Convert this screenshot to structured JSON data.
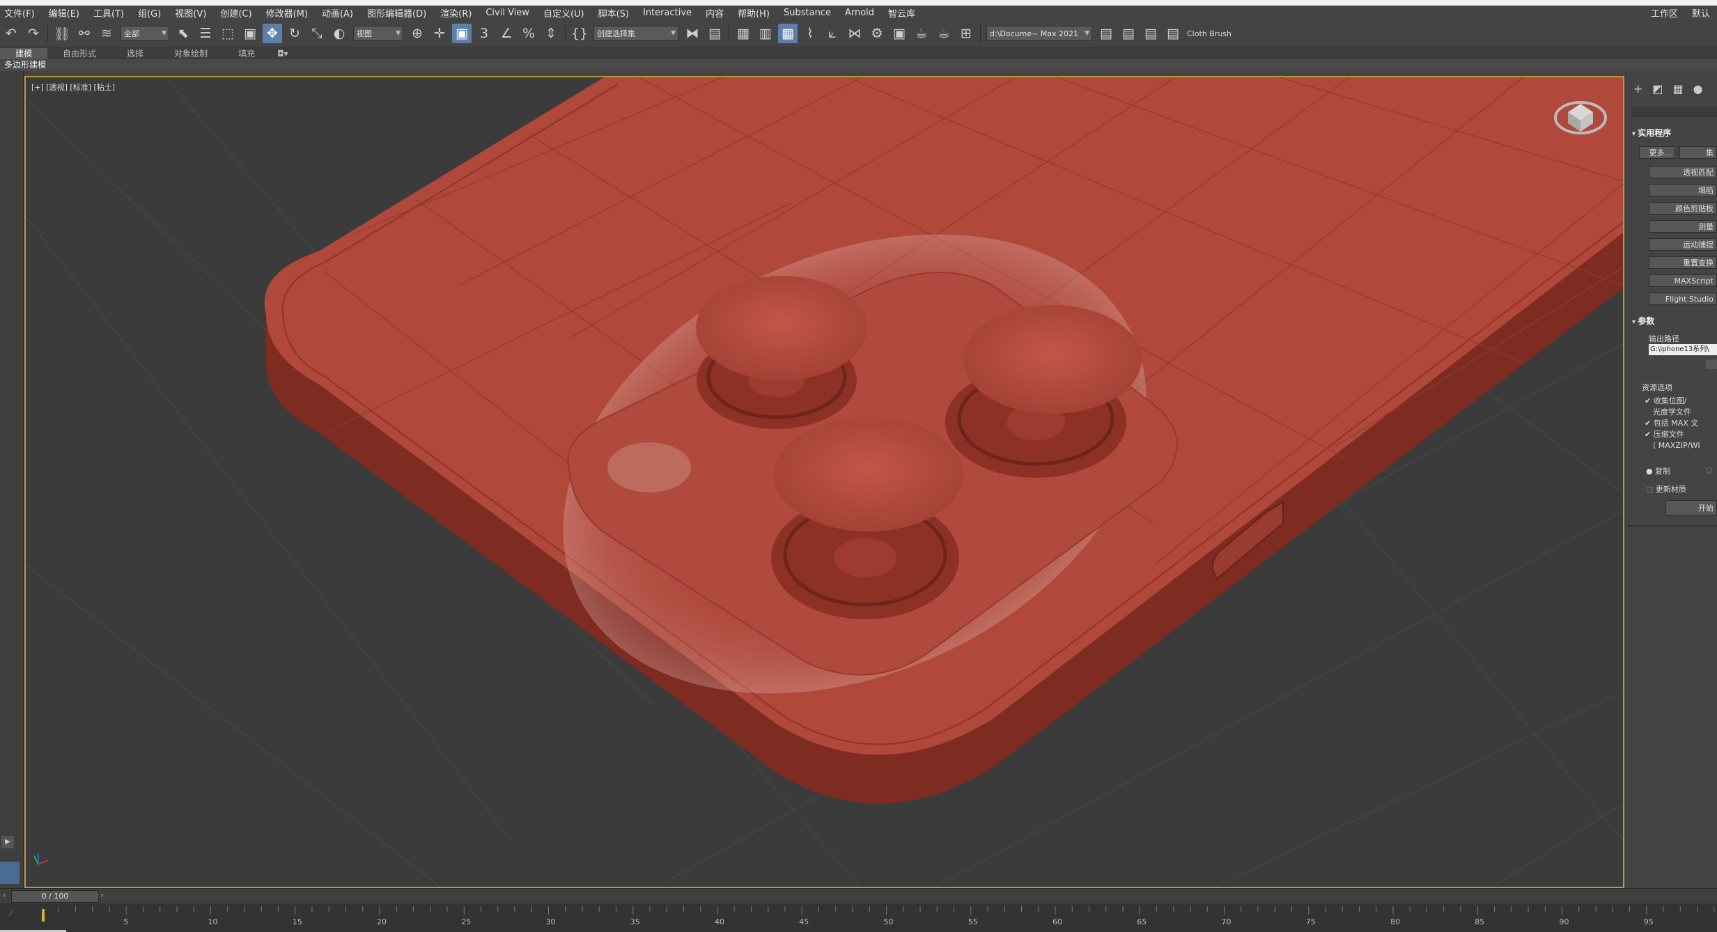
{
  "menu": {
    "items": [
      "文件(F)",
      "编辑(E)",
      "工具(T)",
      "组(G)",
      "视图(V)",
      "创建(C)",
      "修改器(M)",
      "动画(A)",
      "图形编辑器(D)",
      "渲染(R)",
      "Civil View",
      "自定义(U)",
      "脚本(S)",
      "Interactive",
      "内容",
      "帮助(H)",
      "Substance",
      "Arnold",
      "智云库"
    ],
    "right": [
      "工作区",
      "默认"
    ]
  },
  "toolbar": {
    "selection_filter": "全部",
    "coord_system": "视图",
    "named_selection": "创建选择集",
    "project_path": "d:\\Docume~ Max 2021",
    "extra_label": "Cloth Brush"
  },
  "ribbon": {
    "tabs": [
      "建模",
      "自由形式",
      "选择",
      "对象绘制",
      "填充"
    ],
    "active": "建模",
    "sub_label": "多边形建模"
  },
  "viewport": {
    "label": "[+] [透视] [标准] [粘土]"
  },
  "right_panel": {
    "utilities_header": "实用程序",
    "more_button": "更多...",
    "sets_button": "集",
    "utility_buttons": [
      "透视匹配",
      "塌陷",
      "颜色剪贴板",
      "测量",
      "运动捕捉",
      "重置变换",
      "MAXScript",
      "Flight Studio"
    ],
    "params_header": "参数",
    "output_path_label": "输出路径",
    "output_path_value": "G:\\iphone13系列\\",
    "resource_options_label": "资源选项",
    "checks": [
      "收集位图/",
      "光度学文件",
      "包括 MAX 文",
      "压缩文件",
      "( MAXZIP/WI"
    ],
    "radio_copy": "复制",
    "update_materials": "更新材质",
    "start_button": "开始"
  },
  "timeline": {
    "frame_label": "0 / 100",
    "ticks": [
      "5",
      "10",
      "15",
      "20",
      "25",
      "30",
      "35",
      "40",
      "45",
      "50",
      "55",
      "60",
      "65",
      "70",
      "75",
      "80",
      "85",
      "90",
      "95"
    ]
  },
  "colors": {
    "model_face": "#b0483c",
    "model_side": "#7e2b22",
    "viewport_bg": "#3b3b3b",
    "viewport_border": "#b59a3a",
    "active_tool": "#5d7fa8"
  }
}
